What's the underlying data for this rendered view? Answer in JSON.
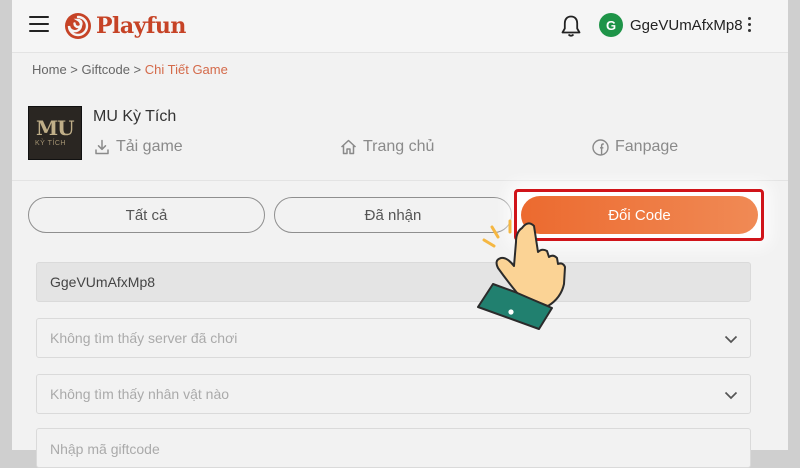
{
  "header": {
    "logo_text": "Playfun",
    "user_initial": "G",
    "username": "GgeVUmAfxMp8"
  },
  "breadcrumb": {
    "home": "Home",
    "sep1": " > ",
    "giftcode": "Giftcode",
    "sep2": " > ",
    "current": "Chi Tiết Game"
  },
  "game": {
    "thumb_logo": "MU",
    "thumb_sub": "KỲ TÍCH",
    "title": "MU Kỳ Tích",
    "download_label": "Tải game",
    "home_label": "Trang chủ",
    "fanpage_label": "Fanpage"
  },
  "tabs": {
    "all": "Tất cả",
    "received": "Đã nhận",
    "redeem": "Đổi Code"
  },
  "form": {
    "username_value": "GgeVUmAfxMp8",
    "server_placeholder": "Không tìm thấy server đã chơi",
    "character_placeholder": "Không tìm thấy nhân vật nào",
    "code_placeholder": "Nhập mã giftcode"
  },
  "colors": {
    "brand": "#c64326",
    "accent": "#ec6a2f",
    "highlight": "#d0141a",
    "avatar": "#1e9448"
  }
}
